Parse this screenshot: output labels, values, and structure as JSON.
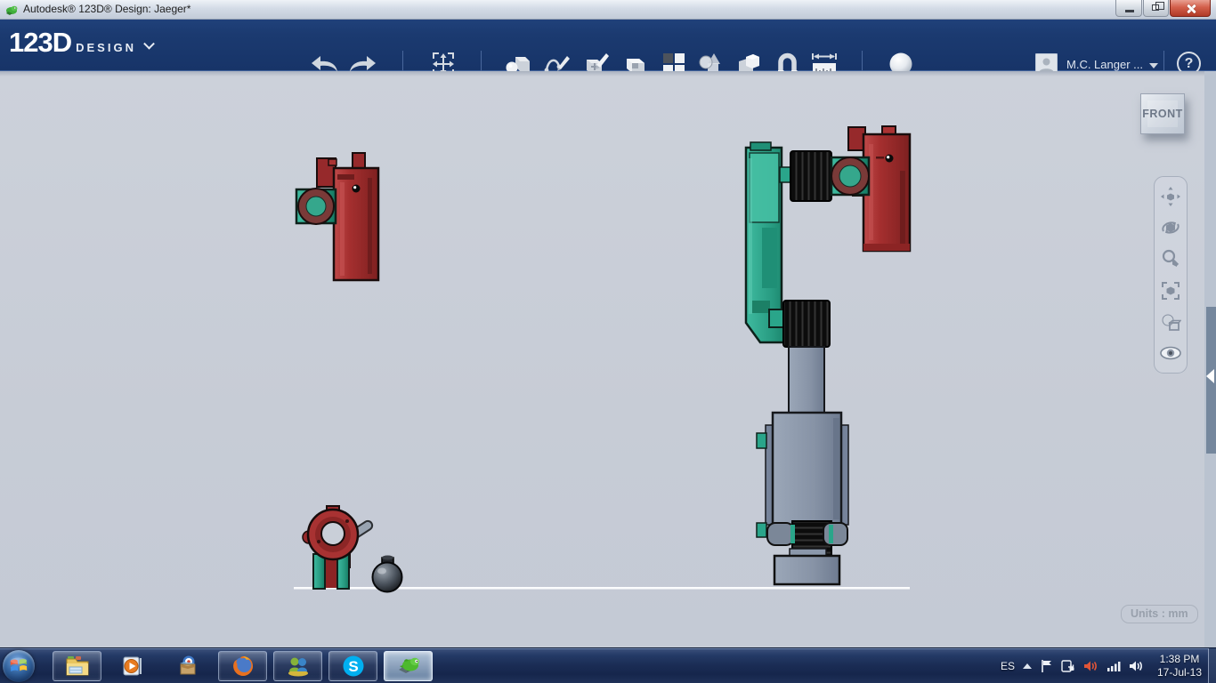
{
  "window": {
    "title": "Autodesk® 123D® Design: Jaeger*"
  },
  "toolbar": {
    "logo_primary": "123D",
    "logo_secondary": "DESIGN",
    "user_name": "M.C. Langer  ...",
    "help_label": "?",
    "icons": [
      "undo",
      "redo",
      "transform-move",
      "primitives",
      "sketch",
      "construct",
      "modify",
      "pattern",
      "group",
      "combine",
      "snap",
      "measure",
      "material-sphere"
    ]
  },
  "viewcube": {
    "label": "FRONT"
  },
  "canvas": {
    "units_label": "Units : mm"
  },
  "nav_rail": {
    "icons": [
      "pan",
      "orbit",
      "zoom",
      "fit",
      "shade",
      "hide"
    ]
  },
  "scene": {
    "parts": [
      "red-gun-part-left",
      "robot-arm-assembly",
      "servo-wheel-with-ball"
    ],
    "ground_line": true
  },
  "colors": {
    "toolbar_bg": "#1b3a70",
    "canvas_bg": "#c9cfd8",
    "model_red": "#a83232",
    "model_teal": "#2aa58a",
    "model_gray": "#8b98ab",
    "knurl_black": "#0d0d0d",
    "taskbar_bg": "#1a2c54"
  },
  "taskbar": {
    "apps": [
      "windows-explorer",
      "media-player",
      "games-box",
      "firefox",
      "messenger",
      "skype",
      "123d-design"
    ],
    "skype_letter": "S",
    "tray": {
      "language": "ES",
      "time": "1:38 PM",
      "date": "17-Jul-13"
    }
  }
}
